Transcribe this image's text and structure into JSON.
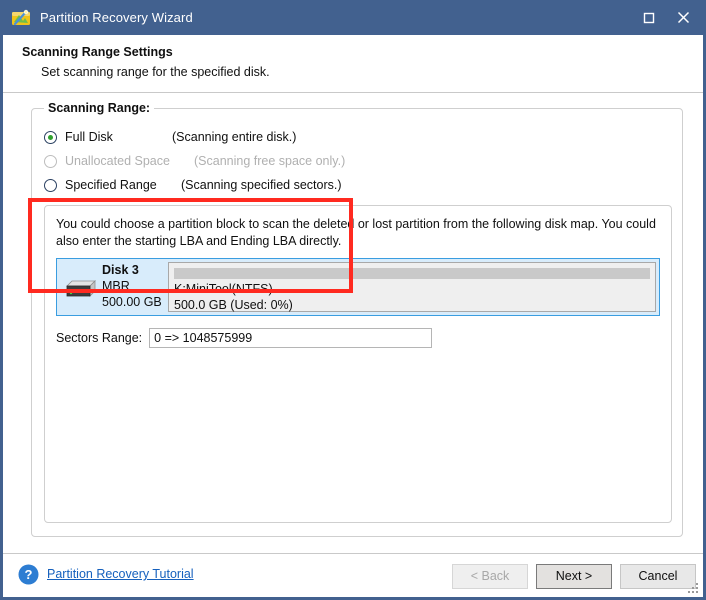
{
  "window": {
    "title": "Partition Recovery Wizard",
    "icon": "partition-wizard-icon",
    "maximize_label": "Maximize",
    "close_label": "Close"
  },
  "header": {
    "title": "Scanning Range Settings",
    "subtitle": "Set scanning range for the specified disk."
  },
  "scanning_range": {
    "legend": "Scanning Range:",
    "options": [
      {
        "label": "Full Disk",
        "description": "(Scanning entire disk.)",
        "checked": true,
        "disabled": false
      },
      {
        "label": "Unallocated Space",
        "description": "(Scanning free space only.)",
        "checked": false,
        "disabled": true
      },
      {
        "label": "Specified Range",
        "description": "(Scanning specified sectors.)",
        "checked": false,
        "disabled": false
      }
    ]
  },
  "disk_map": {
    "hint": "You could choose a partition block to scan the deleted or lost partition from the following disk map. You could also enter the starting LBA and Ending LBA directly.",
    "disk": {
      "name": "Disk 3",
      "scheme": "MBR",
      "capacity": "500.00 GB",
      "icon": "hard-disk-icon"
    },
    "partition": {
      "label": "K:MiniTool(NTFS)",
      "size": "500.0 GB (Used: 0%)",
      "used_percent": 0
    }
  },
  "sectors_range": {
    "label": "Sectors Range:",
    "value": "0 => 1048575999",
    "placeholder": ""
  },
  "footer": {
    "help_icon": "question-mark-icon",
    "tutorial_link": "Partition Recovery Tutorial",
    "buttons": {
      "back": "< Back",
      "next": "Next >",
      "cancel": "Cancel"
    }
  },
  "colors": {
    "titlebar": "#42618F",
    "link": "#1560bd",
    "selection": "#d8ecfb",
    "selection_border": "#3a9de0",
    "annotation": "#ff2a20",
    "radio_dot": "#2ea02e"
  }
}
